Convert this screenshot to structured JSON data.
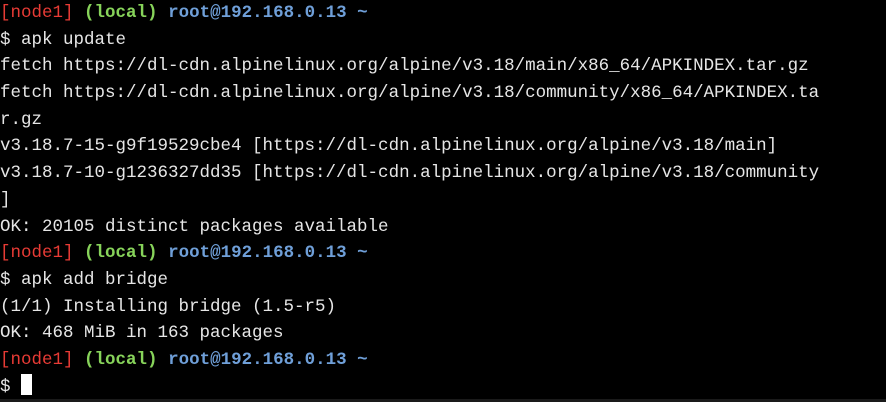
{
  "terminal": {
    "prompt1": {
      "node": "[node1]",
      "local": "(local)",
      "userhost": "root@192.168.0.13",
      "tilde": "~"
    },
    "cmd1": "$ apk update",
    "out1": "fetch https://dl-cdn.alpinelinux.org/alpine/v3.18/main/x86_64/APKINDEX.tar.gz",
    "out2a": "fetch https://dl-cdn.alpinelinux.org/alpine/v3.18/community/x86_64/APKINDEX.ta",
    "out2b": "r.gz",
    "out3": "v3.18.7-15-g9f19529cbe4 [https://dl-cdn.alpinelinux.org/alpine/v3.18/main]",
    "out4a": "v3.18.7-10-g1236327dd35 [https://dl-cdn.alpinelinux.org/alpine/v3.18/community",
    "out4b": "]",
    "out5": "OK: 20105 distinct packages available",
    "prompt2": {
      "node": "[node1]",
      "local": "(local)",
      "userhost": "root@192.168.0.13",
      "tilde": "~"
    },
    "cmd2": "$ apk add bridge",
    "out6": "(1/1) Installing bridge (1.5-r5)",
    "out7": "OK: 468 MiB in 163 packages",
    "prompt3": {
      "node": "[node1]",
      "local": "(local)",
      "userhost": "root@192.168.0.13",
      "tilde": "~"
    },
    "cmd3": "$"
  }
}
